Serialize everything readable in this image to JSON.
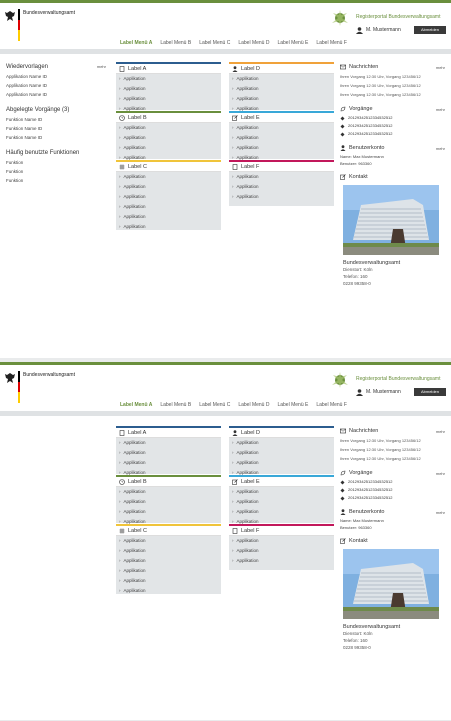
{
  "header": {
    "org": "Bundesverwaltungsamt",
    "portal": "Registerportal Bundesverwaltungsamt",
    "user": "M. Mustermann",
    "logout": "Abmelden"
  },
  "nav": [
    "Label Menü A",
    "Label Menü B",
    "Label Menü C",
    "Label Menü D",
    "Label Menü E",
    "Label Menü F"
  ],
  "colors": {
    "green": "#6a8f3d",
    "boxA": "#2c5d8f",
    "boxB": "#6a8f3d",
    "boxC": "#f0c43a",
    "boxD": "#f0a23a",
    "boxE": "#39a8d8",
    "boxF": "#c2185b"
  },
  "left": {
    "wiedervorlagen": {
      "title": "Wiedervorlagen",
      "mehr": "mehr",
      "items": [
        "Applikation Name ID",
        "Applikation Name ID",
        "Applikation Name ID"
      ]
    },
    "abgelegte": {
      "title": "Abgelegte Vorgänge (3)",
      "items": [
        "Funktion Name ID",
        "Funktion Name ID",
        "Funktion Name ID"
      ]
    },
    "haeufig": {
      "title": "Häufig benutzte Funktionen",
      "items": [
        "Funktion",
        "Funktion",
        "Funktion"
      ]
    }
  },
  "boxes": {
    "a": {
      "label": "Label A",
      "items": [
        "Applikation",
        "Applikation",
        "Applikation",
        "Applikation",
        "Applikation"
      ]
    },
    "b": {
      "label": "Label B",
      "items": [
        "Applikation",
        "Applikation",
        "Applikation",
        "Applikation"
      ]
    },
    "c": {
      "label": "Label C",
      "items": [
        "Applikation",
        "Applikation",
        "Applikation",
        "Applikation",
        "Applikation",
        "Applikation"
      ]
    },
    "d": {
      "label": "Label D",
      "items": [
        "Applikation",
        "Applikation",
        "Applikation",
        "Applikation"
      ]
    },
    "e": {
      "label": "Label E",
      "items": [
        "Applikation",
        "Applikation",
        "Applikation",
        "Applikation"
      ]
    },
    "f": {
      "label": "Label F",
      "items": [
        "Applikation",
        "Applikation",
        "Applikation"
      ]
    }
  },
  "right": {
    "nachrichten": {
      "title": "Nachrichten",
      "mehr": "mehr",
      "items": [
        "Ihren Vorgang 12:30 Uhr, Vorgang 123456/12",
        "Ihren Vorgang 12:30 Uhr, Vorgang 123456/12",
        "Ihren Vorgang 12:30 Uhr, Vorgang 123456/12"
      ]
    },
    "vorgaenge": {
      "title": "Vorgänge",
      "mehr": "mehr",
      "items": [
        "20129342512334532512",
        "20129342512334532512",
        "20129342512334532512"
      ]
    },
    "benutzer": {
      "title": "Benutzerkonto",
      "mehr": "mehr",
      "name": "Name: Max Mustermann",
      "account": "Benutzer: 963360"
    },
    "kontakt": {
      "title": "Kontakt",
      "caption": "Bundesverwaltungsamt",
      "city": "Dienstort: Köln",
      "room": "Telefon: 160",
      "phone": "0228 99358-0"
    }
  }
}
